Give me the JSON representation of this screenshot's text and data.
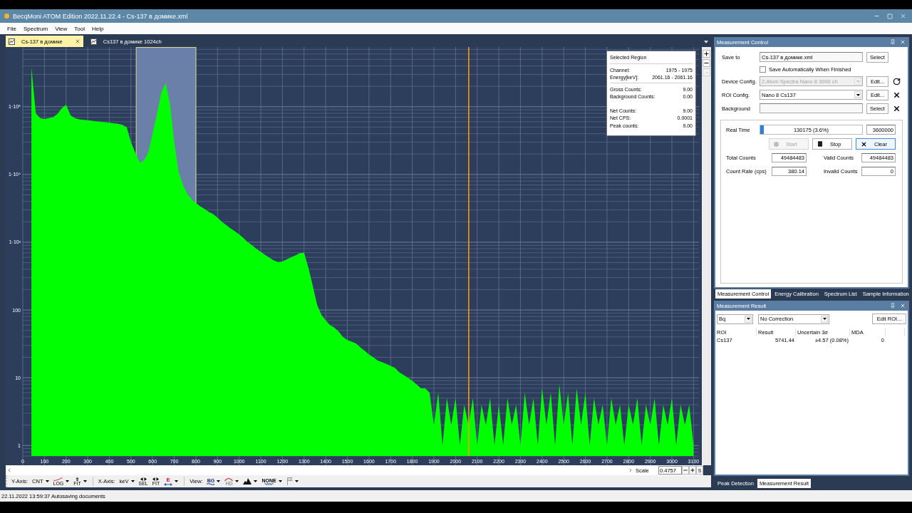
{
  "window": {
    "title": "BecqMoni ATOM Edition 2022.11.22.4 - Cs-137 в домике.xml"
  },
  "menu": [
    "File",
    "Spectrum",
    "View",
    "Tool",
    "Help"
  ],
  "document_tabs": [
    {
      "label": "Cs-137 в домике",
      "selected": true
    },
    {
      "label": "Cs137 в домике 1024ch",
      "selected": false
    }
  ],
  "spectrum": {
    "chart_data": [
      {
        "type": "area",
        "color": "#00ff00",
        "log": true,
        "grid": true,
        "xlim": [
          0,
          3125
        ],
        "ylim": [
          0.7,
          760000
        ],
        "xticks": [
          0,
          100,
          200,
          300,
          400,
          500,
          600,
          700,
          800,
          900,
          1000,
          1100,
          1200,
          1300,
          1400,
          1500,
          1600,
          1700,
          1800,
          1900,
          2000,
          2100,
          2200,
          2300,
          2400,
          2500,
          2600,
          2700,
          2800,
          2900,
          3000,
          3100
        ],
        "yticks": [
          {
            "value": 1,
            "label": "1"
          },
          {
            "value": 10,
            "label": "10"
          },
          {
            "value": 100,
            "label": "100"
          },
          {
            "value": 1000,
            "label": "1·10³"
          },
          {
            "value": 10000,
            "label": "1·10⁴"
          },
          {
            "value": 100000,
            "label": "1·10⁵"
          }
        ],
        "bands": [
          {
            "axis": "x",
            "from": 524,
            "to": 800,
            "color": "#6b80a8"
          }
        ],
        "ref_lines": [
          {
            "axis": "x",
            "value": 2061,
            "color": "#ff9900"
          }
        ],
        "x": [
          40,
          60,
          80,
          100,
          120,
          140,
          160,
          180,
          200,
          220,
          240,
          260,
          280,
          300,
          320,
          340,
          360,
          380,
          400,
          420,
          440,
          460,
          480,
          500,
          520,
          540,
          560,
          580,
          600,
          620,
          640,
          660,
          680,
          700,
          720,
          740,
          760,
          780,
          800,
          820,
          840,
          860,
          880,
          900,
          920,
          940,
          960,
          980,
          1000,
          1020,
          1040,
          1060,
          1080,
          1100,
          1120,
          1140,
          1160,
          1180,
          1200,
          1220,
          1240,
          1260,
          1280,
          1300,
          1320,
          1340,
          1360,
          1380,
          1400,
          1420,
          1440,
          1460,
          1480,
          1500,
          1520,
          1540,
          1560,
          1580,
          1600,
          1620,
          1640,
          1660,
          1680,
          1700,
          1720,
          1740,
          1760,
          1780,
          1800,
          1820,
          1840,
          1860,
          1880,
          1900,
          1920,
          1940,
          1960,
          1980,
          2000,
          2020,
          2040,
          2060,
          2080,
          2100,
          2120,
          2140,
          2160,
          2180,
          2200,
          2220,
          2240,
          2260,
          2280,
          2300,
          2320,
          2340,
          2360,
          2380,
          2400,
          2420,
          2440,
          2460,
          2480,
          2500,
          2520,
          2540,
          2560,
          2580,
          2600,
          2620,
          2640,
          2660,
          2680,
          2700,
          2720,
          2740,
          2760,
          2780,
          2800,
          2820,
          2840,
          2860,
          2880,
          2900,
          2920,
          2940,
          2960,
          2980,
          3000,
          3020,
          3040,
          3060,
          3080,
          3100
        ],
        "values": [
          380000,
          80000,
          68000,
          66000,
          68000,
          70000,
          78000,
          95000,
          107000,
          75000,
          68000,
          65000,
          64000,
          63000,
          62000,
          61000,
          60000,
          59000,
          58000,
          57000,
          56000,
          54000,
          50000,
          30000,
          21000,
          15000,
          16000,
          21000,
          40000,
          78000,
          160000,
          224000,
          110000,
          30000,
          11000,
          7000,
          5200,
          4300,
          3800,
          3400,
          3100,
          2800,
          2600,
          2300,
          2000,
          1800,
          1600,
          1450,
          1300,
          1150,
          1000,
          900,
          800,
          720,
          650,
          590,
          540,
          510,
          520,
          560,
          600,
          640,
          690,
          700,
          420,
          230,
          120,
          85,
          70,
          60,
          55,
          48,
          40,
          36,
          34,
          32,
          28,
          25,
          22,
          20,
          18,
          17,
          16,
          15,
          14,
          12,
          11,
          10,
          9,
          8,
          7,
          7,
          6,
          2,
          6,
          1,
          5,
          2,
          5,
          1,
          4,
          2,
          5,
          1,
          4,
          2,
          5,
          1,
          4,
          1,
          5,
          2,
          4,
          1,
          6,
          2,
          5,
          1,
          7,
          2,
          6,
          1,
          8,
          2,
          6,
          1,
          7,
          2,
          6,
          1,
          5,
          2,
          4,
          1,
          5,
          2,
          4,
          1,
          4,
          2,
          5,
          1,
          4,
          2,
          5,
          1,
          4,
          2,
          5,
          1,
          4,
          2,
          4,
          1
        ]
      }
    ],
    "selected_region": {
      "title": "Selected Region",
      "groups": [
        {
          "kind": "line",
          "rows": [
            {
              "label": "Channel:",
              "value": "1975 - 1975"
            },
            {
              "label": "Energy[keV]:",
              "value": "2061.16 - 2061.16"
            }
          ]
        },
        {
          "kind": "line",
          "rows": [
            {
              "label": "Gross Counts:",
              "value": "9.00"
            },
            {
              "label": "Background Counts:",
              "value": "0.00"
            }
          ]
        },
        {
          "kind": "space",
          "rows": [
            {
              "label": "Net Counts:",
              "value": "9.00"
            },
            {
              "label": "Net CPS:",
              "value": "0.0001"
            },
            {
              "label": "Peak counts:",
              "value": "9.00"
            }
          ]
        }
      ]
    }
  },
  "scale_bar": {
    "label": "Scale",
    "value": "0.4757",
    "button": "S"
  },
  "toolbar": [
    {
      "label": "Y-Axis:",
      "items": [
        {
          "kind": "dropdown",
          "text": "CNT",
          "menu": true
        },
        {
          "kind": "log",
          "text": "LOG",
          "menu": true
        },
        {
          "kind": "fit-y",
          "text": "FIT",
          "menu": true
        }
      ]
    },
    {
      "label": "X-Axis:",
      "items": [
        {
          "kind": "dropdown",
          "text": "keV",
          "menu": true
        },
        {
          "kind": "sel",
          "text": "SEL",
          "menu": false
        },
        {
          "kind": "fit-x",
          "text": "FIT",
          "menu": false
        },
        {
          "kind": "energy",
          "text": "E",
          "menu": true
        }
      ]
    },
    {
      "label": "View:",
      "items": [
        {
          "kind": "bg",
          "text": "BG",
          "menu": true
        },
        {
          "kind": "arc",
          "text": "HD",
          "menu": true
        },
        {
          "kind": "peak",
          "menu": true
        },
        {
          "kind": "none",
          "text": "NONE",
          "menu": true
        },
        {
          "kind": "flag",
          "menu": true
        }
      ]
    }
  ],
  "measurement_control": {
    "title": "Measurement Control",
    "rows": [
      {
        "kind": "input",
        "label": "Save to",
        "value": "Cs-137 в домике.xml",
        "button": "Select"
      },
      {
        "kind": "checkbox",
        "label": "Save Automatically When Finished",
        "checked": false
      },
      {
        "kind": "select",
        "label": "Device Config.",
        "value": "2.Atom Spectra Nano 8 3000 ch",
        "disabled": true,
        "button": "Edit...",
        "extra_button": {
          "kind": "reload"
        }
      },
      {
        "kind": "select",
        "label": "ROI Config.",
        "value": "Nano 8 Cs137",
        "disabled": false,
        "button": "Edit...",
        "extra_button": {
          "kind": "remove"
        }
      },
      {
        "kind": "input",
        "label": "Background",
        "button": "Select",
        "extra_button": {
          "kind": "remove"
        }
      }
    ],
    "run": {
      "label": "Real Time",
      "level": 0.036,
      "progress_text": "130175 (3.6%)",
      "preset": "3600000"
    },
    "buttons": [
      {
        "kind": "start",
        "label": "Start",
        "disabled": true,
        "focused": false
      },
      {
        "kind": "stop",
        "label": "Stop",
        "disabled": false,
        "focused": false
      },
      {
        "kind": "clear",
        "label": "Clear",
        "disabled": false,
        "focused": true
      }
    ],
    "counters": [
      {
        "label": "Total Counts",
        "value": "49484483"
      },
      {
        "label": "Valid Counts",
        "value": "49484483"
      },
      {
        "label": "Count Rate (cps)",
        "value": "380.14"
      },
      {
        "label": "Invalid Counts",
        "value": "0"
      }
    ],
    "tabs": [
      {
        "label": "Measurement Control",
        "selected": true
      },
      {
        "label": "Energy Calibration",
        "selected": false
      },
      {
        "label": "Spectrum List",
        "selected": false
      },
      {
        "label": "Sample Information",
        "selected": false
      }
    ]
  },
  "measurement_result": {
    "title": "Measurement Result",
    "unit": "Bq",
    "correction": "No Correction",
    "button": "Edit ROI...",
    "table": {
      "columns": [
        "ROI",
        "Result",
        "Uncertain 3σ",
        "MDA"
      ],
      "rows": [
        [
          "Cs137",
          "5741.44",
          "±4.57 (0.08%)",
          "0"
        ]
      ]
    },
    "tabs": [
      {
        "label": "Peak Detection",
        "selected": false
      },
      {
        "label": "Measurement Result",
        "selected": true
      }
    ]
  },
  "status_bar": {
    "text": "22.11.2022 13:59:37 Autosaving documents"
  }
}
